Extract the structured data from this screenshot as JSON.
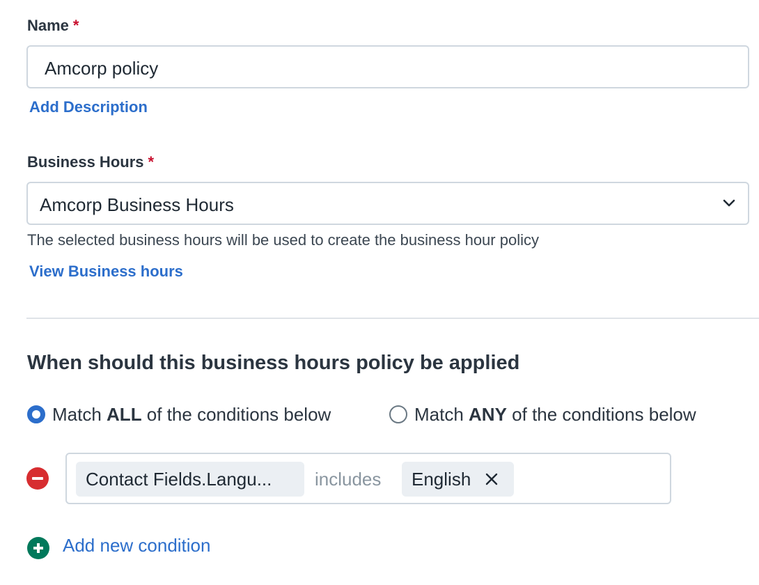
{
  "name_field": {
    "label": "Name",
    "required_mark": "*",
    "value": "Amcorp policy"
  },
  "add_description_link": "Add Description",
  "business_hours_field": {
    "label": "Business Hours",
    "required_mark": "*",
    "selected": "Amcorp Business Hours",
    "help_text": "The selected business hours will be used to create the business hour policy"
  },
  "view_business_hours_link": "View Business hours",
  "conditions_section": {
    "heading": "When should this business hours policy be applied",
    "match_options": [
      {
        "prefix": "Match ",
        "keyword": "ALL",
        "suffix": " of the conditions below",
        "selected": true
      },
      {
        "prefix": "Match ",
        "keyword": "ANY",
        "suffix": " of the conditions below",
        "selected": false
      }
    ],
    "conditions": [
      {
        "field": "Contact Fields.Langu...",
        "operator": "includes",
        "values": [
          "English"
        ]
      }
    ],
    "add_condition_label": "Add new condition"
  },
  "colors": {
    "accent": "#2c6ecb",
    "remove": "#d72d30",
    "add": "#00795b",
    "required": "#c8102e"
  },
  "icons": {
    "dropdown": "chevron-down-icon",
    "remove_condition": "minus-circle-icon",
    "remove_value": "close-icon",
    "add_condition": "plus-circle-icon"
  }
}
